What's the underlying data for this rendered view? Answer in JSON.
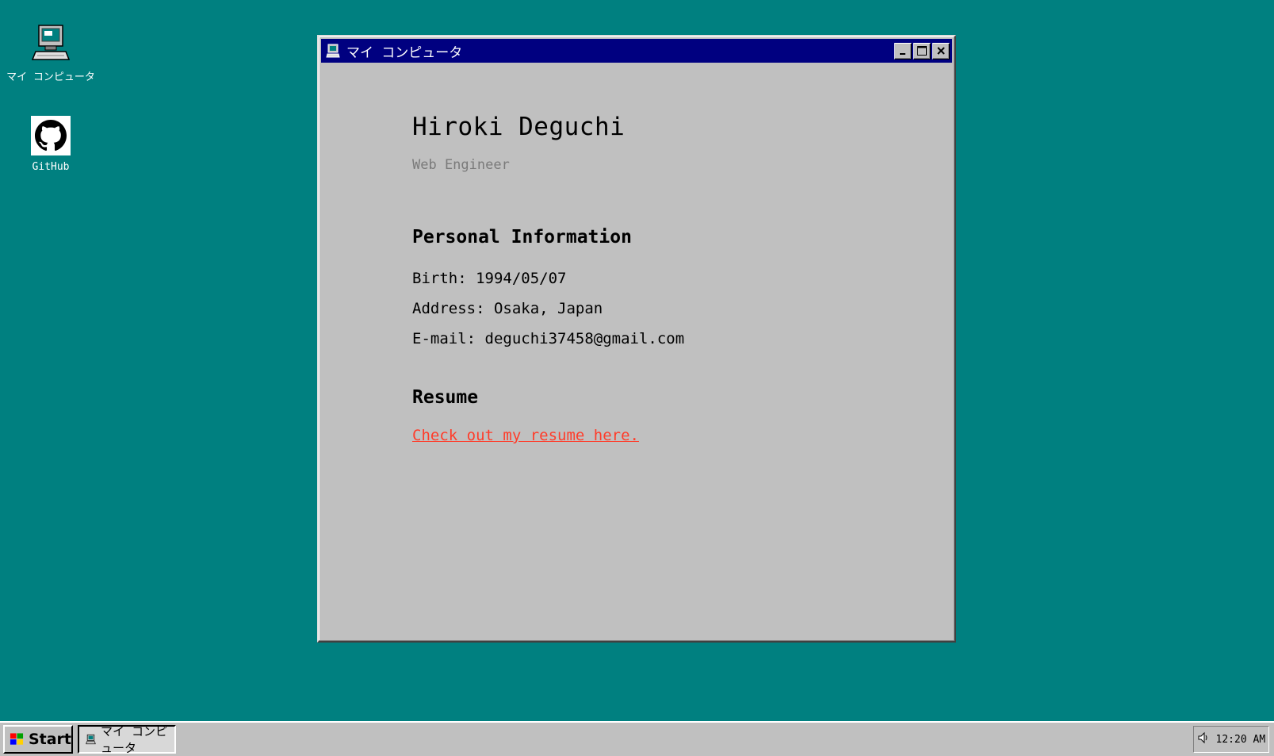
{
  "desktop": {
    "icons": [
      {
        "label": "マイ コンピュータ",
        "icon": "computer-icon"
      },
      {
        "label": "GitHub",
        "icon": "github-icon"
      }
    ]
  },
  "window": {
    "title": "マイ コンピュータ",
    "name": "Hiroki Deguchi",
    "role": "Web Engineer",
    "personal_heading": "Personal Information",
    "birth": "Birth: 1994/05/07",
    "address": "Address: Osaka, Japan",
    "email": "E-mail: deguchi37458@gmail.com",
    "resume_heading": "Resume",
    "resume_link": "Check out my resume here."
  },
  "taskbar": {
    "start_label": "Start",
    "task_label": "マイ コンピュータ",
    "clock": "12:20 AM"
  },
  "colors": {
    "desktop": "#008080",
    "titlebar": "#000080",
    "link": "#ff3c2a"
  }
}
